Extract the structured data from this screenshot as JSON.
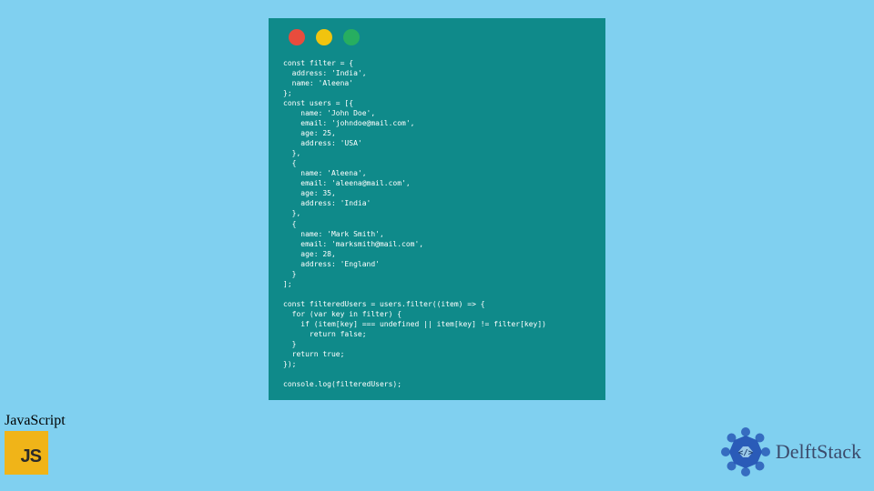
{
  "window": {
    "controls": [
      "red",
      "yellow",
      "green"
    ]
  },
  "code": "const filter = {\n  address: 'India',\n  name: 'Aleena'\n};\nconst users = [{\n    name: 'John Doe',\n    email: 'johndoe@mail.com',\n    age: 25,\n    address: 'USA'\n  },\n  {\n    name: 'Aleena',\n    email: 'aleena@mail.com',\n    age: 35,\n    address: 'India'\n  },\n  {\n    name: 'Mark Smith',\n    email: 'marksmith@mail.com',\n    age: 28,\n    address: 'England'\n  }\n];\n\nconst filteredUsers = users.filter((item) => {\n  for (var key in filter) {\n    if (item[key] === undefined || item[key] != filter[key])\n      return false;\n  }\n  return true;\n});\n\nconsole.log(filteredUsers);",
  "badges": {
    "js_label": "JavaScript",
    "js_logo_text": "JS",
    "delft_text": "DelftStack"
  },
  "colors": {
    "background": "#80d0f0",
    "window": "#0f8a8a",
    "js_logo": "#f0b418",
    "delft_primary": "#2a5bb8"
  }
}
